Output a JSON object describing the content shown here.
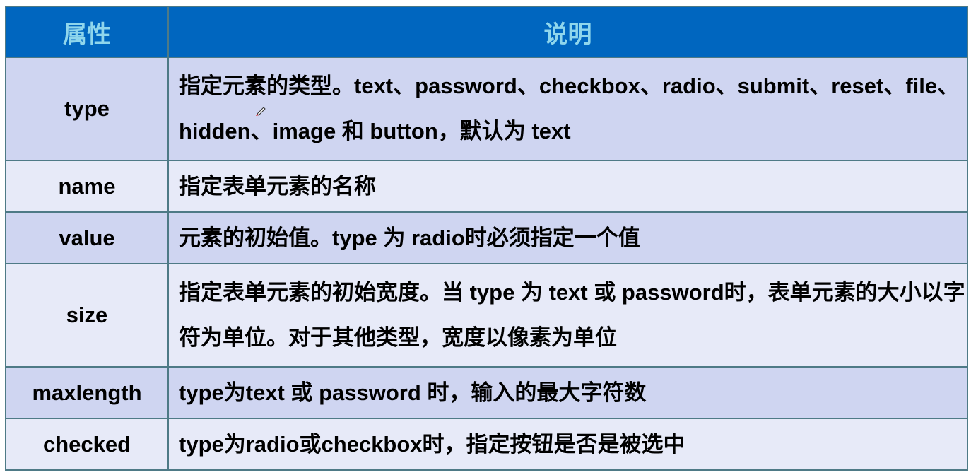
{
  "header": {
    "col_attr": "属性",
    "col_desc": "说明"
  },
  "colors": {
    "header_bg": "#0066bf",
    "header_text": "#8fd6ec",
    "row_dark": "#cfd5f1",
    "row_light": "#e7eaf8",
    "border": "#4e7a86"
  },
  "rows": [
    {
      "attr": "type",
      "desc": "指定元素的类型。text、password、checkbox、radio、submit、reset、file、hidden、image 和 button，默认为 text"
    },
    {
      "attr": "name",
      "desc": "指定表单元素的名称"
    },
    {
      "attr": "value",
      "desc": "元素的初始值。type 为 radio时必须指定一个值"
    },
    {
      "attr": "size",
      "desc": "指定表单元素的初始宽度。当 type 为 text 或 password时，表单元素的大小以字符为单位。对于其他类型，宽度以像素为单位"
    },
    {
      "attr": "maxlength",
      "desc": "type为text 或 password 时，输入的最大字符数"
    },
    {
      "attr": "checked",
      "desc": "type为radio或checkbox时，指定按钮是否是被选中"
    }
  ]
}
